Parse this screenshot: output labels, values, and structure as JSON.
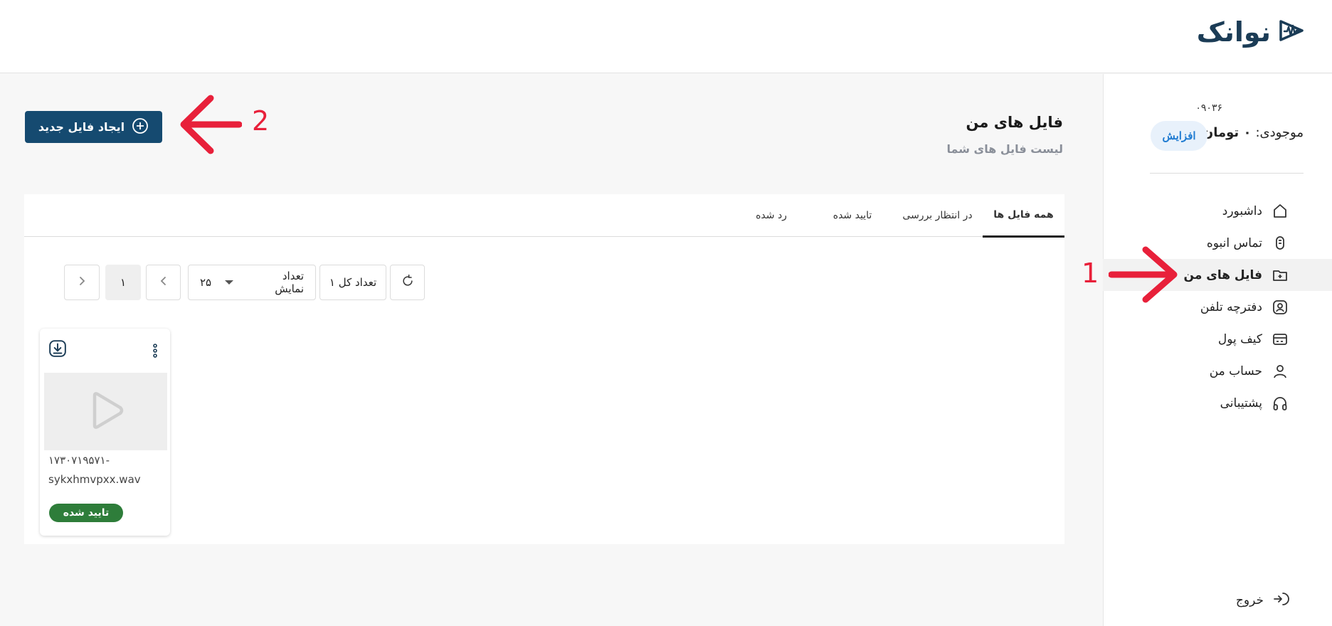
{
  "app": {
    "logo_text": "نوانک"
  },
  "sidebar": {
    "balance_amount": "۰۹۰۳۶",
    "balance_label": "موجودی:",
    "balance_value": "۰ تومان",
    "increase_label": "افزایش",
    "items": [
      {
        "label": "داشبورد",
        "icon": "home-icon"
      },
      {
        "label": "تماس انبوه",
        "icon": "microphone-icon"
      },
      {
        "label": "فایل های من",
        "icon": "folder-plus-icon",
        "active": true
      },
      {
        "label": "دفترچه تلفن",
        "icon": "contact-book-icon"
      },
      {
        "label": "کیف پول",
        "icon": "wallet-icon"
      },
      {
        "label": "حساب من",
        "icon": "user-icon"
      },
      {
        "label": "پشتیبانی",
        "icon": "headphones-icon"
      }
    ],
    "logout_label": "خروج"
  },
  "annotations": {
    "one": "1",
    "two": "2",
    "color": "#e8203a"
  },
  "main": {
    "title": "فایل های من",
    "subtitle": "لیست فایل های شما",
    "new_file_label": "ایجاد فایل جدید",
    "tabs": [
      {
        "label": "همه فایل ها",
        "active": true
      },
      {
        "label": "در انتظار بررسی"
      },
      {
        "label": "تایید شده"
      },
      {
        "label": "رد شده"
      }
    ],
    "toolbar": {
      "total_label": "تعداد کل ۱",
      "per_page_label": "تعداد نمایش",
      "per_page_value": "۲۵",
      "page_number": "۱"
    },
    "files": [
      {
        "name_line1": "۱۷۳۰۷۱۹۵۷۱-",
        "name_line2": "sykxhmvpxx.wav",
        "status": "تایید شده",
        "status_color": "#2e7d3a"
      }
    ]
  },
  "colors": {
    "primary": "#154a70",
    "brand": "#1b3c56",
    "accent_light": "#e8f1fb"
  }
}
